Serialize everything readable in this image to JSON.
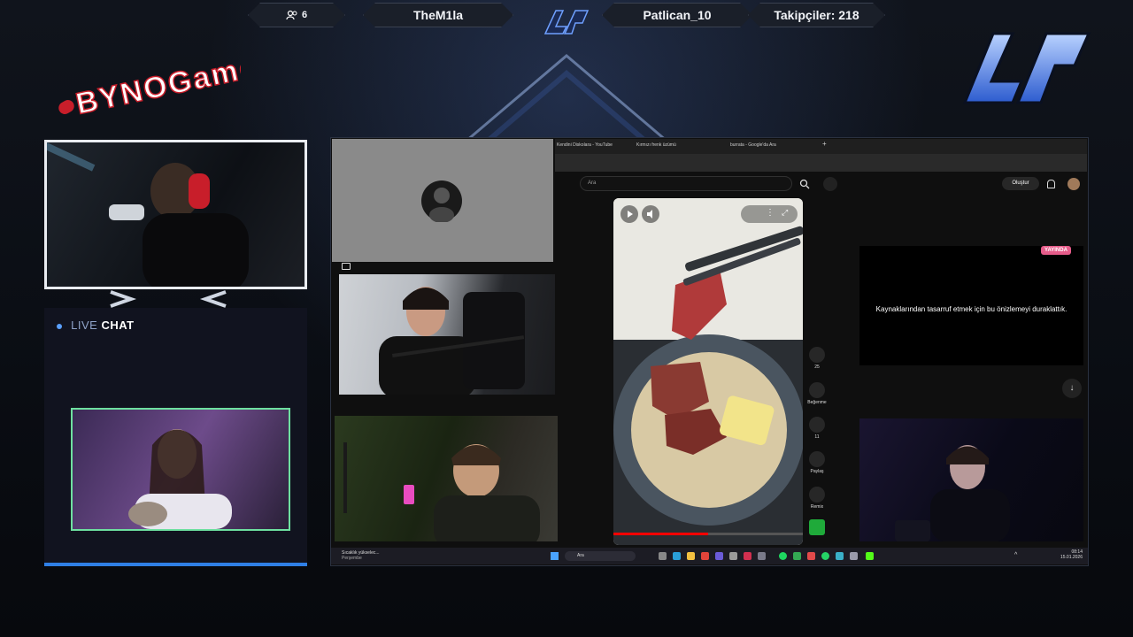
{
  "topbar": {
    "viewers": "6",
    "left_name": "TheM1la",
    "right_name": "Patlican_10",
    "followers": "Takipçiler: 218"
  },
  "brand": "BYNOGame",
  "chat": {
    "live": "LIVE",
    "word": "CHAT"
  },
  "browser": {
    "tabs": [
      "Kendini Diskolara - YouTube",
      "Kırmızı frenk üzümü",
      "burrata - Google'da Ara"
    ],
    "search_placeholder": "Ara",
    "create_label": "Oluştur",
    "actions": [
      {
        "icon": "like-icon",
        "label": "25"
      },
      {
        "icon": "dislike-icon",
        "label": "Beğenme"
      },
      {
        "icon": "comment-icon",
        "label": "11"
      },
      {
        "icon": "share-icon",
        "label": "Paylaş"
      },
      {
        "icon": "remix-icon",
        "label": "Remix"
      }
    ],
    "live_badge": "YAYINDA",
    "live_message": "Kaynaklarından tasarruf etmek için bu önizlemeyi duraklattık."
  },
  "taskbar": {
    "weather_title": "Sıcaklık yükselec...",
    "weather_sub": "Perşembe",
    "search": "Ara",
    "time": "08:14",
    "date": "15.01.2026"
  },
  "colors": {
    "accent_blue": "#2f7fe6",
    "cam_border_green": "#6ee0a0",
    "badge_pink": "#e65c8a"
  }
}
